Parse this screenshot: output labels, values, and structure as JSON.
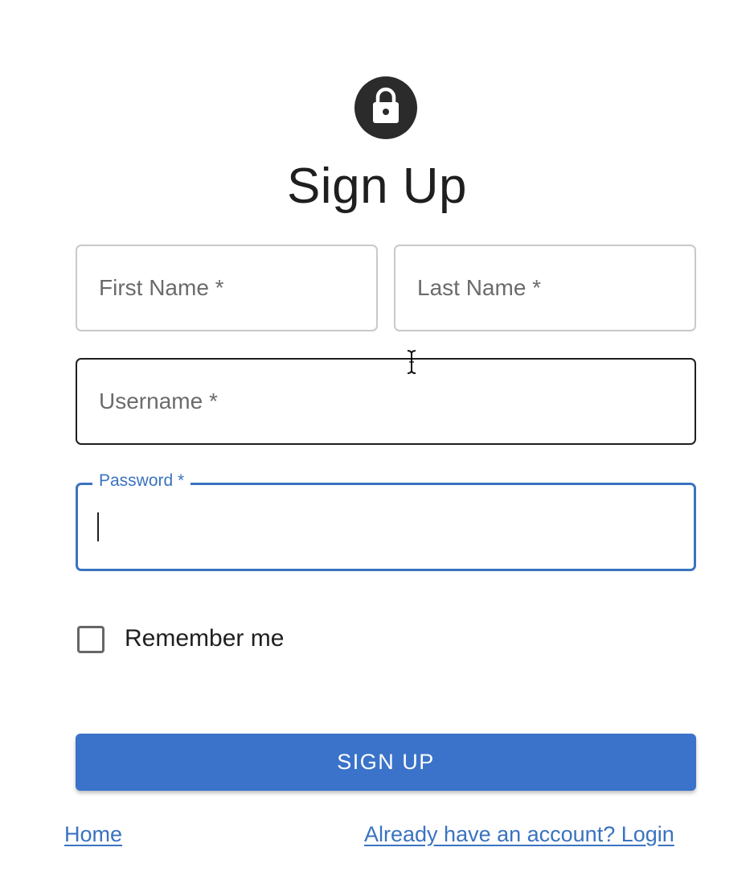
{
  "form": {
    "title": "Sign Up",
    "first_name_placeholder": "First Name *",
    "last_name_placeholder": "Last Name *",
    "username_placeholder": "Username *",
    "password_label": "Password *",
    "password_value": "",
    "remember_label": "Remember me",
    "remember_checked": false,
    "submit_label": "SIGN UP"
  },
  "footer": {
    "home_link": "Home",
    "login_link": "Already have an account? Login"
  },
  "icons": {
    "avatar": "lock-icon",
    "pointer": "text-cursor-icon"
  },
  "colors": {
    "accent": "#3a73c9",
    "avatar_bg": "#2b2b2b",
    "text": "#1f1f1f"
  }
}
